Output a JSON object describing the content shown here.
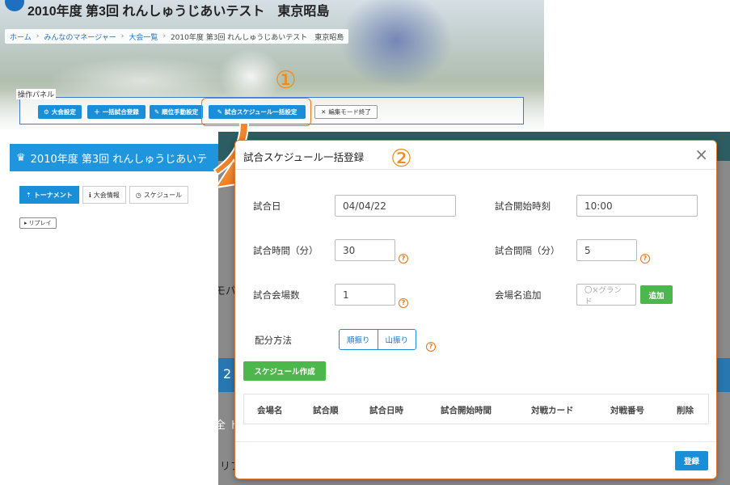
{
  "page": {
    "title": "2010年度 第3回 れんしゅうじあいテスト　東京昭島",
    "breadcrumb": [
      "ホーム",
      "みんなのマネージャー",
      "大会一覧",
      "2010年度 第3回 れんしゅうじあいテスト　東京昭島"
    ]
  },
  "operation_panel": {
    "label": "操作パネル",
    "buttons": [
      {
        "label": "大会設定",
        "icon": "gear-icon"
      },
      {
        "label": "一括試合登録",
        "icon": "plus-icon"
      },
      {
        "label": "順位手動設定",
        "icon": "edit-icon"
      },
      {
        "label": "試合スケジュール一括設定",
        "icon": "edit-icon"
      },
      {
        "label": "編集モード終了",
        "icon": "close-icon"
      }
    ]
  },
  "annotations": {
    "step1": "①",
    "step2": "②"
  },
  "tournament_header": {
    "title": "2010年度 第3回 れんしゅうじあいテ",
    "icon": "crown-icon"
  },
  "tabs": [
    {
      "label": "トーナメント",
      "icon": "tournament-icon",
      "active": true
    },
    {
      "label": "大会情報",
      "icon": "info-icon",
      "active": false
    },
    {
      "label": "スケジュール",
      "icon": "clock-icon",
      "active": false
    }
  ],
  "replay_button": "リプレイ",
  "behind_fragments": {
    "a": "モパ",
    "b": "2",
    "c": "全 ト",
    "d": "リプ"
  },
  "modal": {
    "title": "試合スケジュール一括登録",
    "close_label": "×",
    "fields": {
      "match_date": {
        "label": "試合日",
        "value": "04/04/22"
      },
      "start_time": {
        "label": "試合開始時刻",
        "value": "10:00"
      },
      "duration": {
        "label": "試合時間（分）",
        "value": "30"
      },
      "interval": {
        "label": "試合間隔（分）",
        "value": "5"
      },
      "venue_count": {
        "label": "試合会場数",
        "value": "1"
      },
      "venue_add": {
        "label": "会場名追加",
        "placeholder": "〇×グランド",
        "button": "追加"
      },
      "distribution": {
        "label": "配分方法",
        "options": [
          "順振り",
          "山振り"
        ]
      }
    },
    "help_glyph": "?",
    "create_button": "スケジュール作成",
    "table_headers": [
      "会場名",
      "試合順",
      "試合日時",
      "試合開始時間",
      "対戦カード",
      "対戦番号",
      "削除"
    ],
    "submit_button": "登録"
  },
  "colors": {
    "accent_blue": "#1a8fd8",
    "accent_orange": "#f08a18",
    "green": "#4cb84c"
  }
}
